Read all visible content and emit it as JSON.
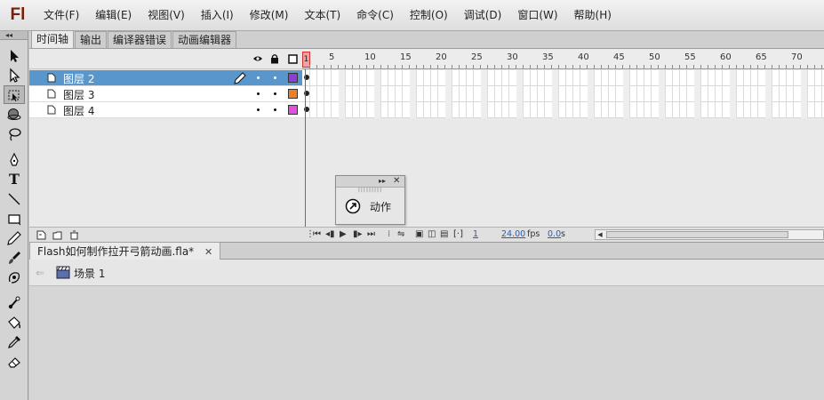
{
  "app": {
    "logo": "Fl"
  },
  "menu": [
    "文件(F)",
    "编辑(E)",
    "视图(V)",
    "插入(I)",
    "修改(M)",
    "文本(T)",
    "命令(C)",
    "控制(O)",
    "调试(D)",
    "窗口(W)",
    "帮助(H)"
  ],
  "tools_collapse": "◂◂",
  "panel_tabs": [
    "时间轴",
    "输出",
    "编译器错误",
    "动画编辑器"
  ],
  "layers": [
    {
      "name": "图层 2",
      "selected": true,
      "color": "#8b3fd9"
    },
    {
      "name": "图层 3",
      "selected": false,
      "color": "#ef7f22"
    },
    {
      "name": "图层 4",
      "selected": false,
      "color": "#e34fe3"
    }
  ],
  "ruler": {
    "current_frame": "1",
    "labels": [
      "5",
      "10",
      "15",
      "20",
      "25",
      "30",
      "35",
      "40",
      "45",
      "50",
      "55",
      "60",
      "65",
      "70"
    ]
  },
  "timeline_status": {
    "current_frame": "1",
    "fps_value": "24.00",
    "fps_unit": "fps",
    "time_value": "0.0",
    "time_unit": "s"
  },
  "action_panel": {
    "label": "动作",
    "expand": "▸▸",
    "close": "✕",
    "grip": "|||||||||"
  },
  "document": {
    "tab_label": "Flash如何制作拉开弓箭动画.fla*",
    "close": "✕"
  },
  "edit_bar": {
    "back": "⇐",
    "scene_label": "场景 1"
  },
  "colors": {
    "selection": "#5896cc",
    "playhead": "#d64040"
  }
}
